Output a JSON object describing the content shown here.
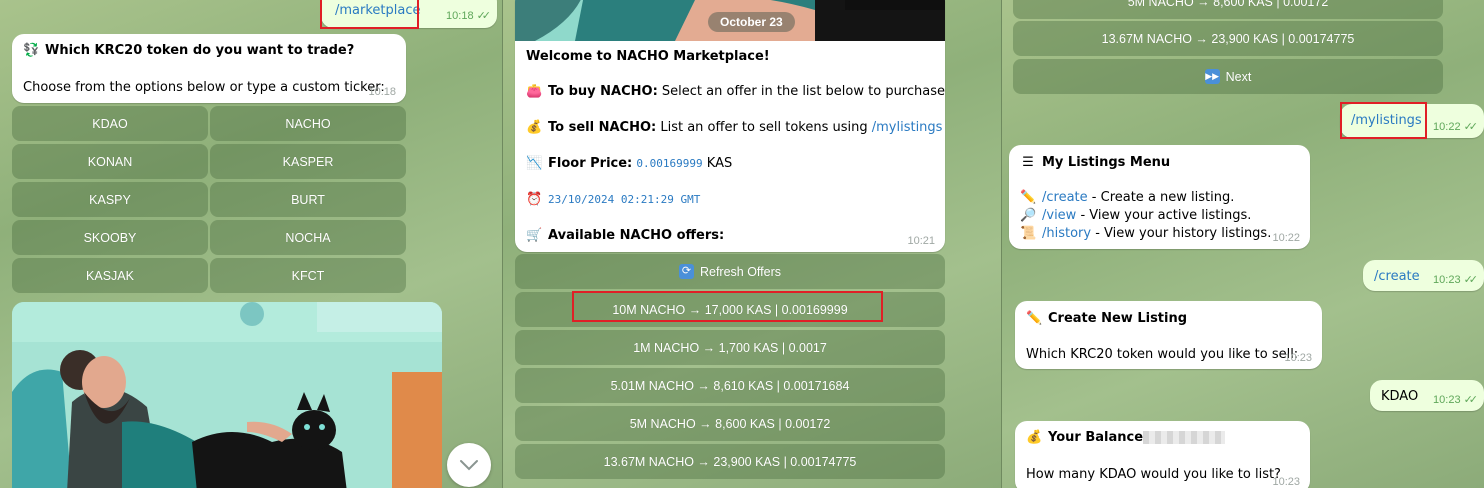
{
  "panel1": {
    "cmd_marketplace": "/marketplace",
    "cmd_time": "10:18",
    "question_title": "Which KRC20 token do you want to trade?",
    "question_emoji": "💱",
    "question_body": "Choose from the options below or type a custom ticker:",
    "question_time": "10:18",
    "tokens": [
      [
        "KDAO",
        "NACHO"
      ],
      [
        "KONAN",
        "KASPER"
      ],
      [
        "KASPY",
        "BURT"
      ],
      [
        "SKOOBY",
        "NOCHA"
      ],
      [
        "KASJAK",
        "KFCT"
      ]
    ]
  },
  "panel2": {
    "date": "October 23",
    "welcome": "Welcome to NACHO Marketplace!",
    "buy_label": "To buy NACHO:",
    "buy_text": " Select an offer in the list below to purchase.",
    "sell_label": "To sell NACHO:",
    "sell_text": " List an offer to sell tokens using ",
    "sell_link": "/mylistings",
    "floor_label": "Floor Price:",
    "floor_value": "0.00169999",
    "floor_unit": " KAS",
    "timestamp": "23/10/2024 02:21:29 GMT",
    "available": "Available NACHO offers:",
    "msg_time": "10:21",
    "refresh": "Refresh Offers",
    "offers": [
      "10M NACHO → 17,000 KAS | 0.00169999",
      "1M NACHO → 1,700 KAS | 0.0017",
      "5.01M NACHO → 8,610 KAS | 0.00171684",
      "5M NACHO → 8,600 KAS | 0.00172",
      "13.67M NACHO → 23,900 KAS | 0.00174775"
    ]
  },
  "panel3": {
    "top_partial": "5M NACHO → 8,600 KAS | 0.00172",
    "top_offer": "13.67M NACHO → 23,900 KAS | 0.00174775",
    "next": "Next",
    "cmd_mylistings": "/mylistings",
    "cmd_mylistings_time": "10:22",
    "menu_title": "My Listings Menu",
    "menu_items": [
      {
        "link": "/create",
        "text": " - Create a new listing."
      },
      {
        "link": "/view",
        "text": " - View your active listings."
      },
      {
        "link": "/history",
        "text": " - View your history listings."
      }
    ],
    "menu_time": "10:22",
    "cmd_create": "/create",
    "cmd_create_time": "10:23",
    "create_title": "Create New Listing",
    "create_body": "Which KRC20 token would you like to sell:",
    "create_time": "10:23",
    "reply_kdao": "KDAO",
    "reply_kdao_time": "10:23",
    "balance_title": "Your Balance",
    "balance_body": "How many KDAO would you like to list?",
    "balance_time": "10:23"
  }
}
